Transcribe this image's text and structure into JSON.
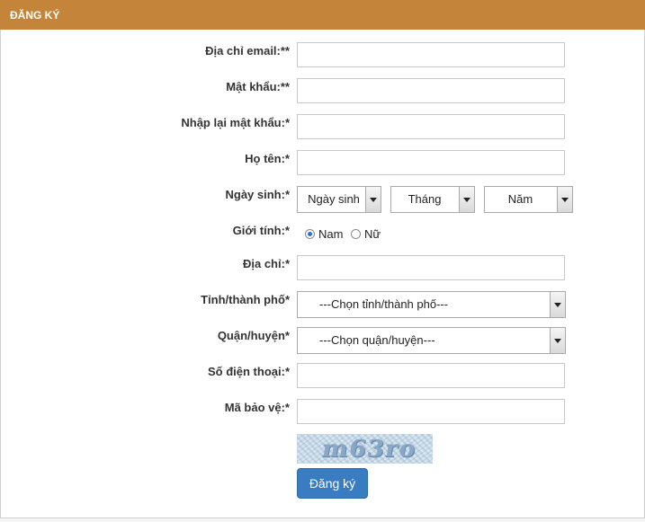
{
  "header": {
    "title": "ĐĂNG KÝ"
  },
  "form": {
    "email_label": "Địa chỉ email:**",
    "password_label": "Mật khẩu:**",
    "confirm_password_label": "Nhập lại mật khẩu:*",
    "fullname_label": "Họ tên:*",
    "birthday_label": "Ngày sinh:*",
    "birthday_day": "Ngày sinh",
    "birthday_month": "Tháng",
    "birthday_year": "Năm",
    "gender_label": "Giới tính:*",
    "gender_male": "Nam",
    "gender_female": "Nữ",
    "gender_selected": "Nam",
    "address_label": "Địa chỉ:*",
    "province_label": "Tỉnh/thành phố*",
    "province_value": "---Chọn tỉnh/thành phố---",
    "district_label": "Quận/huyện*",
    "district_value": "---Chọn quận/huyện---",
    "phone_label": "Số điện thoại:*",
    "captcha_label": "Mã bảo vệ:*",
    "captcha_text": "m63ro",
    "submit_label": "Đăng ký"
  },
  "colors": {
    "header_bg": "#c4853a",
    "button_bg": "#3a7cc2"
  }
}
